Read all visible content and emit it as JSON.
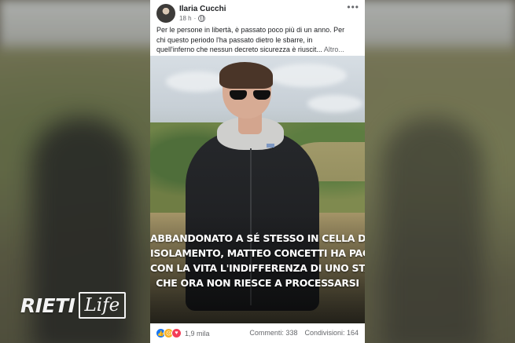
{
  "post": {
    "author": "Ilaria Cucchi",
    "time": "18 h",
    "text_lines": [
      "Per le persone in libertà, è passato poco più di un anno. Per",
      "chi questo periodo l'ha passato dietro le sbarre, in",
      "quell'inferno che nessun decreto sicurezza è riuscit..."
    ],
    "see_more": "Altro..."
  },
  "image": {
    "caption_lines": [
      "ABBANDONATO A SÉ STESSO IN CELLA DI",
      "ISOLAMENTO, MATTEO CONCETTI HA PAGATO",
      "CON LA VITA L'INDIFFERENZA DI UNO STATO",
      "CHE ORA NON RIESCE A PROCESSARSI"
    ]
  },
  "footer": {
    "reaction_count": "1,9 mila",
    "comments": "Commenti: 338",
    "shares": "Condivisioni: 164",
    "reaction_icons": [
      "like-icon",
      "sad-icon",
      "love-icon"
    ]
  },
  "watermark": {
    "brand": "RIETI",
    "brand_sub": "Life"
  },
  "colors": {
    "like": "#1877f2",
    "sad": "#f7b125",
    "love": "#f33e58",
    "text": "#1c1e21",
    "muted": "#65676b"
  }
}
